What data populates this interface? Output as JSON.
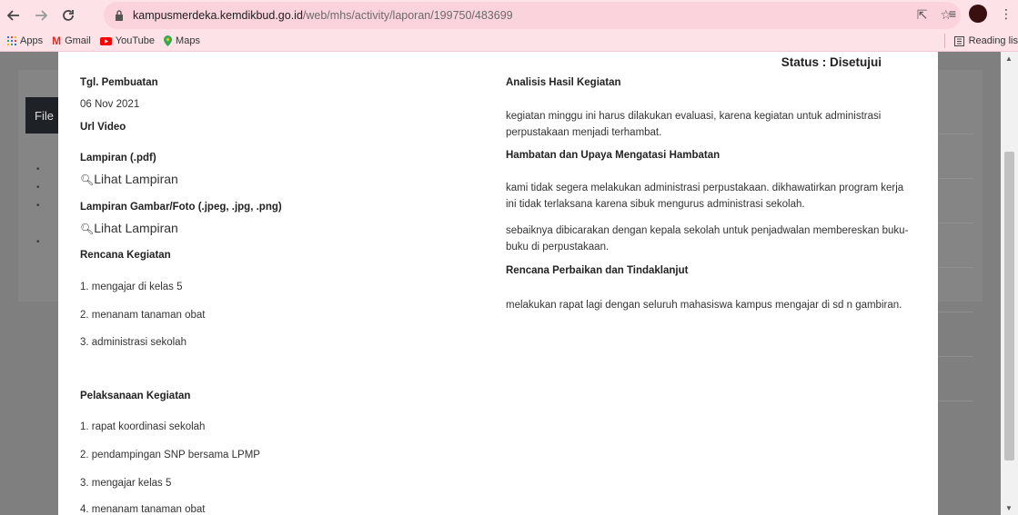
{
  "browser": {
    "url_host": "kampusmerdeka.kemdikbud.go.id",
    "url_path": "/web/mhs/activity/laporan/199750/483699",
    "bookmarks": [
      {
        "label": "Apps",
        "icon": "apps-grid-icon"
      },
      {
        "label": "Gmail",
        "icon": "gmail-icon"
      },
      {
        "label": "YouTube",
        "icon": "youtube-icon"
      },
      {
        "label": "Maps",
        "icon": "maps-icon"
      }
    ],
    "reading_list": "Reading lis"
  },
  "background": {
    "tab_label": "File"
  },
  "modal": {
    "status": "Status : Disetujui",
    "left": {
      "tgl_label": "Tgl. Pembuatan",
      "tgl_value": "06 Nov 2021",
      "url_video_label": "Url Video",
      "lampiran_pdf_label": "Lampiran (.pdf)",
      "lihat_lampiran_1": "Lihat Lampiran",
      "lampiran_gambar_label": "Lampiran Gambar/Foto (.jpeg, .jpg, .png)",
      "lihat_lampiran_2": "Lihat Lampiran",
      "rencana_label": "Rencana Kegiatan",
      "rencana_items": [
        "1. mengajar di kelas 5",
        "2. menanam tanaman obat",
        "3. administrasi sekolah"
      ],
      "pelaksanaan_label": "Pelaksanaan Kegiatan",
      "pelaksanaan_items": [
        "1. rapat koordinasi sekolah",
        "2. pendampingan SNP bersama LPMP",
        "3. mengajar kelas 5",
        "4. menanam tanaman obat"
      ]
    },
    "right": {
      "analisis_label": "Analisis Hasil Kegiatan",
      "analisis_text": "kegiatan minggu ini harus dilakukan evaluasi, karena kegiatan untuk administrasi perpustakaan menjadi terhambat.",
      "hambatan_label": "Hambatan dan Upaya Mengatasi Hambatan",
      "hambatan_text_1": "kami tidak segera melakukan administrasi perpustakaan. dikhawatirkan program kerja ini tidak terlaksana karena sibuk mengurus administrasi sekolah.",
      "hambatan_text_2": "sebaiknya dibicarakan dengan kepala sekolah untuk penjadwalan membereskan buku-buku di perpustakaan.",
      "rencana_perbaikan_label": "Rencana Perbaikan dan Tindaklanjut",
      "rencana_perbaikan_text": "melakukan rapat lagi dengan seluruh mahasiswa kampus mengajar di sd n gambiran."
    }
  }
}
